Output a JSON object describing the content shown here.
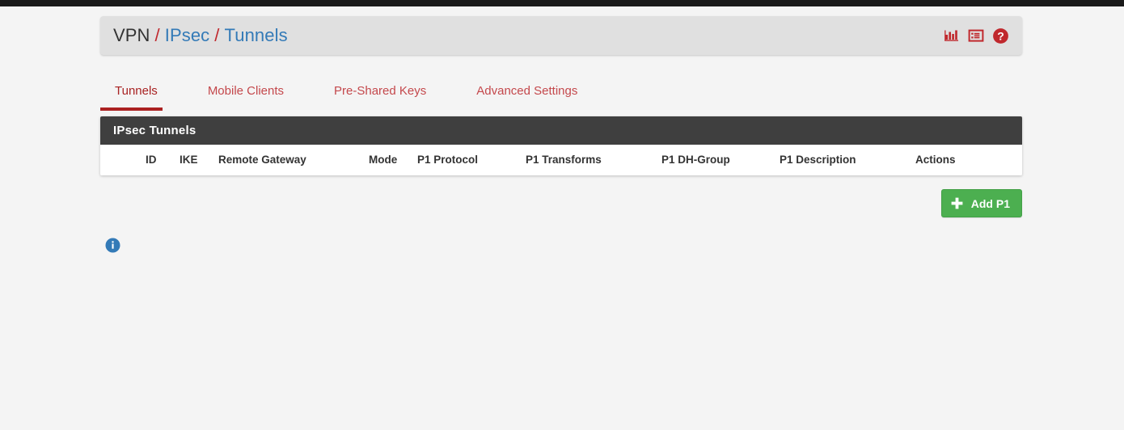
{
  "breadcrumb": {
    "root": "VPN",
    "separator": "/",
    "items": [
      {
        "label": "IPsec"
      },
      {
        "label": "Tunnels"
      }
    ]
  },
  "header_icons": [
    {
      "name": "status-chart-icon",
      "title": "Status"
    },
    {
      "name": "log-list-icon",
      "title": "Log"
    },
    {
      "name": "help-icon",
      "title": "Help"
    }
  ],
  "tabs": [
    {
      "label": "Tunnels",
      "active": true
    },
    {
      "label": "Mobile Clients",
      "active": false
    },
    {
      "label": "Pre-Shared Keys",
      "active": false
    },
    {
      "label": "Advanced Settings",
      "active": false
    }
  ],
  "panel": {
    "title": "IPsec Tunnels",
    "columns": [
      "ID",
      "IKE",
      "Remote Gateway",
      "Mode",
      "P1 Protocol",
      "P1 Transforms",
      "P1 DH-Group",
      "P1 Description",
      "Actions"
    ],
    "rows": []
  },
  "actions": {
    "add_p1_label": "Add P1"
  },
  "info": {
    "icon": "info-circle-icon"
  },
  "colors": {
    "accent_red": "#ab2121",
    "link_blue": "#337ab7",
    "panel_header_gray": "#3f3f3f",
    "add_button_green": "#4caf50",
    "info_blue": "#337ab7",
    "page_background": "#f4f4f4",
    "breadcrumb_background": "#e0e0e0"
  }
}
